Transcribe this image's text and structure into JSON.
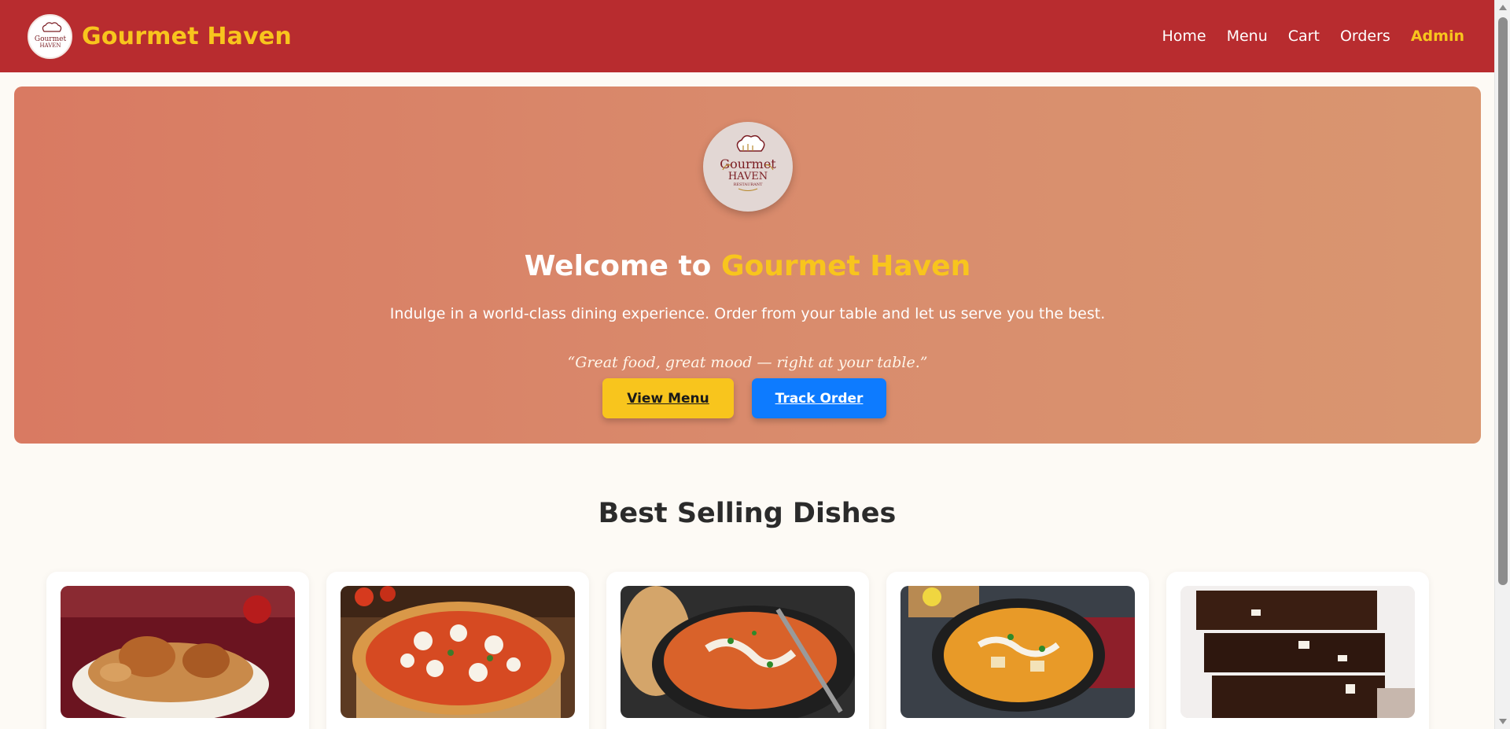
{
  "header": {
    "brand_name": "Gourmet Haven",
    "logo_icon": "chef-hat-logo",
    "nav": [
      {
        "label": "Home"
      },
      {
        "label": "Menu"
      },
      {
        "label": "Cart"
      },
      {
        "label": "Orders"
      },
      {
        "label": "Admin"
      }
    ]
  },
  "hero": {
    "logo": {
      "line1": "Gourmet",
      "line2": "HAVEN",
      "line3": "RESTAURANT"
    },
    "title_prefix": "Welcome to",
    "title_accent": "Gourmet Haven",
    "subtitle": "Indulge in a world-class dining experience. Order from your table and let us serve you the best.",
    "quote": "“Great food, great mood — right at your table.”",
    "buttons": {
      "view_menu": "View Menu",
      "track_order": "Track Order"
    }
  },
  "best_sellers": {
    "title": "Best Selling Dishes",
    "dishes": [
      {
        "image": "chicken-biryani-photo"
      },
      {
        "image": "margherita-pizza-photo"
      },
      {
        "image": "butter-chicken-naan-photo"
      },
      {
        "image": "paneer-curry-photo"
      },
      {
        "image": "chocolate-brownie-photo"
      }
    ]
  },
  "colors": {
    "header_bg": "#b82c2f",
    "accent_yellow": "#f8c51d",
    "accent_blue": "#0d7bff",
    "hero_gradient_start": "#d97a62",
    "hero_gradient_end": "#d99670"
  }
}
